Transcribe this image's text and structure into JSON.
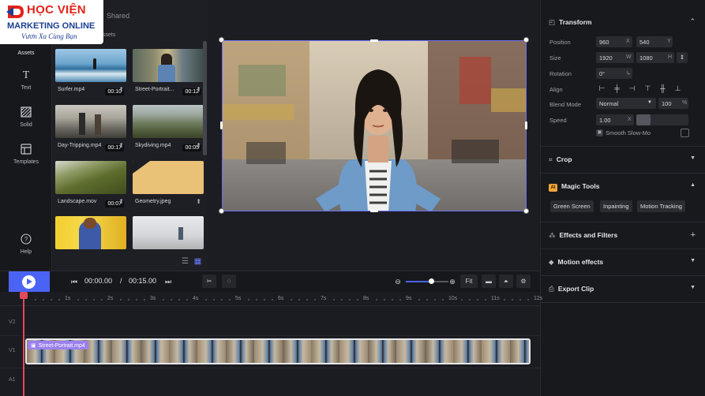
{
  "logo": {
    "line1": "HỌC VIỆN",
    "line2": "MARKETING ONLINE",
    "line3": "Vươn Xa Cùng Bạn",
    "colors": {
      "red": "#e2231a",
      "blue": "#1c3f94"
    }
  },
  "rail": {
    "items": [
      {
        "label": "Assets",
        "icon": "assets-icon"
      },
      {
        "label": "Text",
        "icon": "text-icon"
      },
      {
        "label": "Solid",
        "icon": "solid-icon"
      },
      {
        "label": "Templates",
        "icon": "templates-icon"
      },
      {
        "label": "Help",
        "icon": "help-icon"
      }
    ]
  },
  "assets_panel": {
    "tab_shared": "Shared",
    "tab_assets": "ssets",
    "items": [
      {
        "name": "Surfer.mp4",
        "duration": "00:10"
      },
      {
        "name": "Street-Portrait...",
        "duration": "00:12"
      },
      {
        "name": "Day-Tripping.mp4",
        "duration": "00:17"
      },
      {
        "name": "Skydiving.mp4",
        "duration": "00:05"
      },
      {
        "name": "Landscape.mov",
        "duration": "00:07"
      },
      {
        "name": "Geometry.jpeg",
        "duration": ""
      },
      {
        "name": "",
        "duration": ""
      },
      {
        "name": "",
        "duration": ""
      }
    ]
  },
  "transport": {
    "current_time": "00:00.00",
    "separator": "/",
    "total_time": "00:15.00",
    "fit_label": "Fit",
    "zoom_level": 0.6
  },
  "timeline": {
    "ticks": [
      "1s",
      "2s",
      "3s",
      "4s",
      "5s",
      "6s",
      "7s",
      "8s",
      "9s",
      "10s",
      "11s",
      "12s"
    ],
    "tracks": [
      "V2",
      "V1",
      "A1"
    ],
    "clip_label": "Street-Portrait.mp4"
  },
  "transform": {
    "title": "Transform",
    "position_label": "Position",
    "position_x": "960",
    "position_x_unit": "X",
    "position_y": "540",
    "position_y_unit": "Y",
    "size_label": "Size",
    "size_w": "1920",
    "size_w_unit": "W",
    "size_h": "1080",
    "size_h_unit": "H",
    "rotation_label": "Rotation",
    "rotation_value": "0°",
    "align_label": "Align",
    "blend_label": "Blend Mode",
    "blend_value": "Normal",
    "opacity_value": "100",
    "opacity_unit": "%",
    "speed_label": "Speed",
    "speed_value": "1.00",
    "speed_unit": "X",
    "smooth_slow_mo": "Smooth Slow-Mo"
  },
  "sections": {
    "crop": "Crop",
    "magic_tools": "Magic Tools",
    "ai_badge": "AI",
    "magic_chips": [
      "Green Screen",
      "Inpainting",
      "Motion Tracking"
    ],
    "effects": "Effects and Filters",
    "motion": "Motion effects",
    "export": "Export Clip"
  },
  "colors": {
    "accent": "#4b63f5",
    "selection": "#6d6ff5",
    "playhead": "#e14a5a",
    "clip_label": "#9b7ff0",
    "magic": "#f1a43a"
  }
}
